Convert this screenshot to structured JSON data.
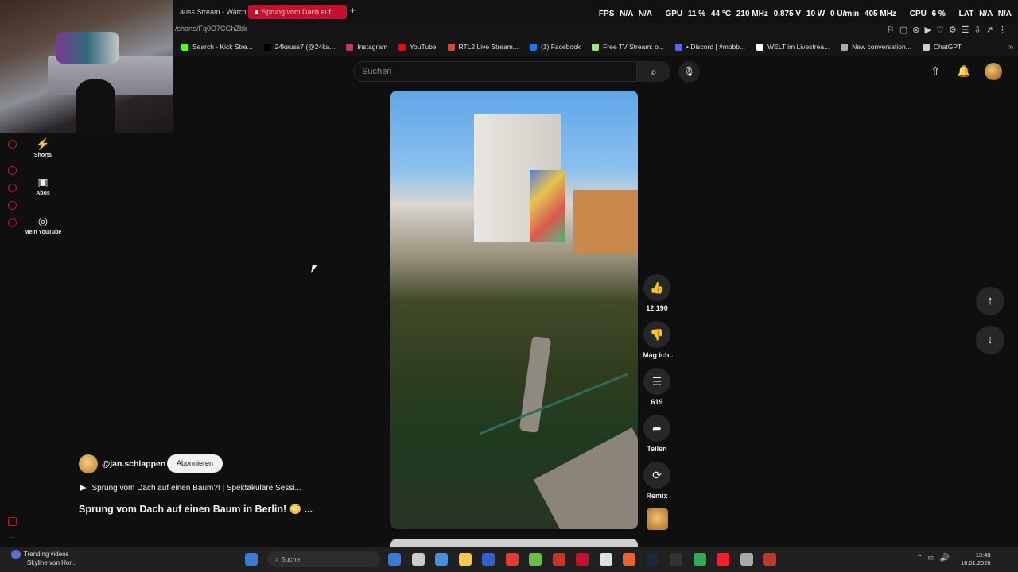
{
  "browser": {
    "tabs": [
      {
        "label": "auss Stream - Watch l"
      },
      {
        "label": "Sprung vom Dach auf"
      }
    ],
    "new_tab_symbol": "+",
    "url": "/shorts/Fq0O7CGhZbk",
    "bookmarks": [
      {
        "label": "Search - Kick Stre...",
        "color": "#53fc18"
      },
      {
        "label": "24kauss7 (@24ka...",
        "color": "#000000"
      },
      {
        "label": "Instagram",
        "color": "#d62976"
      },
      {
        "label": "YouTube",
        "color": "#ff0000"
      },
      {
        "label": "RTL2 Live Stream...",
        "color": "#e8412c"
      },
      {
        "label": "(1) Facebook",
        "color": "#1877f2"
      },
      {
        "label": "Free TV Stream: o...",
        "color": "#9ee87a"
      },
      {
        "label": "• Discord | #mobb...",
        "color": "#5865f2"
      },
      {
        "label": "WELT im Livestrea...",
        "color": "#ffffff"
      },
      {
        "label": "New conversation...",
        "color": "#aaaaaa"
      },
      {
        "label": "ChatGPT",
        "color": "#cccccc"
      }
    ],
    "bookmarks_more": "»"
  },
  "hw_stats": {
    "fps_label": "FPS",
    "fps": "N/A",
    "fps2": "N/A",
    "gpu_label": "GPU",
    "gpu_load": "11 %",
    "gpu_temp": "44 °C",
    "gpu_clock": "210 MHz",
    "gpu_volt": "0.875 V",
    "gpu_power": "10 W",
    "gpu_fan": "0 U/min",
    "gpu_mem": "405 MHz",
    "cpu_label": "CPU",
    "cpu_load": "6 %",
    "lat_label": "LAT",
    "lat": "N/A",
    "lat2": "N/A"
  },
  "youtube": {
    "search_placeholder": "Suchen",
    "nav": [
      {
        "label": "Shorts",
        "icon": "shorts-icon",
        "glyph": "⚡"
      },
      {
        "label": "Abos",
        "icon": "subscriptions-icon",
        "glyph": "▣"
      },
      {
        "label": "Mein YouTube",
        "icon": "account-circle-icon",
        "glyph": "◎"
      }
    ],
    "actions": {
      "like_count": "12.190",
      "dislike_label": "Mag ich .",
      "comments_count": "619",
      "share_label": "Teilen",
      "remix_label": "Remix"
    },
    "channel": {
      "handle": "@jan.schlappen",
      "subscribe_label": "Abonnieren"
    },
    "playlist_label": "Sprung vom Dach auf einen Baum?! | Spektakuläre Sessi...",
    "video_title": "Sprung vom Dach auf einen Baum in Berlin! 😳 ..."
  },
  "taskbar": {
    "weather_line1": "Trending videos",
    "weather_line2": "Skyline von Hor...",
    "search_placeholder": "Suche",
    "time": "13:48",
    "date": "18.01.2026",
    "apps": [
      "#3a7bd5",
      "#cccccc",
      "#4a90d9",
      "#f2c94c",
      "#2f5fd0",
      "#e03c31",
      "#6abf40",
      "#c0392b",
      "#c8102e",
      "#e0e0e0",
      "#e8642c",
      "#1b2838",
      "#333333",
      "#34a853",
      "#ff1b2d",
      "#aaaaaa",
      "#c0392b"
    ]
  }
}
